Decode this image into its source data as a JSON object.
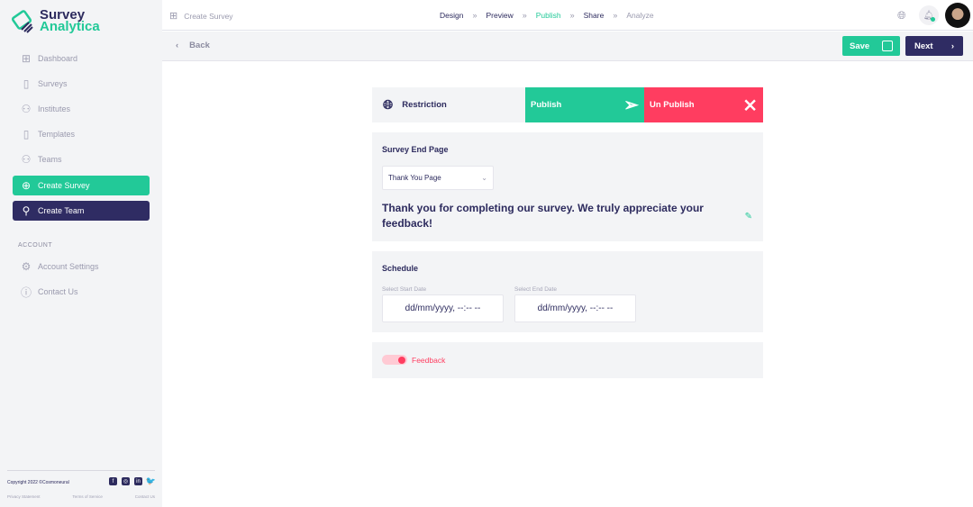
{
  "brand": {
    "line1": "Survey",
    "line2": "Analytica"
  },
  "sidebar": {
    "items": [
      {
        "label": "Dashboard",
        "icon": "grid-icon"
      },
      {
        "label": "Surveys",
        "icon": "document-icon"
      },
      {
        "label": "Institutes",
        "icon": "users-icon"
      },
      {
        "label": "Templates",
        "icon": "document-icon"
      },
      {
        "label": "Teams",
        "icon": "users-icon"
      }
    ],
    "create_survey": "Create Survey",
    "create_team": "Create Team",
    "account_heading": "ACCOUNT",
    "account_settings": "Account Settings",
    "contact_us": "Contact Us"
  },
  "footer": {
    "copyright": "Copyright 2022 ©Cosmoneural",
    "privacy": "Privacy Statement",
    "terms": "Terms of Service",
    "contact": "Contact Us"
  },
  "topbar": {
    "crumb": "Create Survey",
    "steps": [
      "Design",
      "Preview",
      "Publish",
      "Share",
      "Analyze"
    ],
    "active_step": "Publish"
  },
  "subbar": {
    "back": "Back",
    "save": "Save",
    "next": "Next"
  },
  "tabs": {
    "restriction": "Restriction",
    "publish": "Publish",
    "unpublish": "Un Publish"
  },
  "end_page": {
    "title": "Survey End Page",
    "selected": "Thank You Page",
    "message": "Thank you for completing our survey.  We truly appreciate your feedback!"
  },
  "schedule": {
    "title": "Schedule",
    "start_label": "Select Start Date",
    "end_label": "Select End Date",
    "start_value": "dd/mm/yyyy, --:-- --",
    "end_value": "dd/mm/yyyy, --:-- --"
  },
  "feedback": {
    "label": "Feedback",
    "enabled": true
  },
  "colors": {
    "green": "#22c998",
    "navy": "#2f2c63",
    "red": "#ff3d60"
  }
}
